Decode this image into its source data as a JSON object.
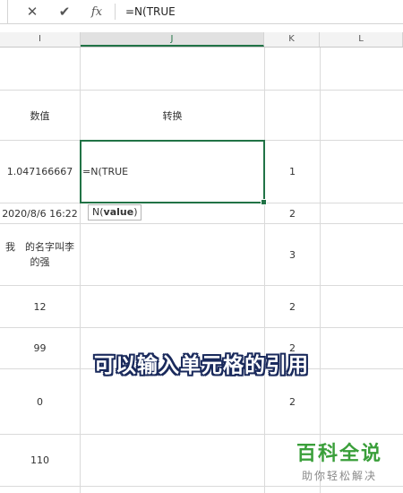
{
  "formula_bar": {
    "cancel_icon": "✕",
    "enter_icon": "✔",
    "fx_label": "fx",
    "content": "=N(TRUE"
  },
  "columns": [
    "I",
    "J",
    "K",
    "L"
  ],
  "selected_column": "J",
  "header_row": {
    "i": "数值",
    "j": "转换"
  },
  "rows": [
    {
      "i": "1.047166667",
      "j": "=N(TRUE",
      "k": "1"
    },
    {
      "i": "2020/8/6 16:22",
      "j": "",
      "k": "2"
    },
    {
      "i": "我　的名字叫李的强",
      "j": "",
      "k": "3"
    },
    {
      "i": "12",
      "j": "",
      "k": "2"
    },
    {
      "i": "99",
      "j": "",
      "k": "2"
    },
    {
      "i": "0",
      "j": "",
      "k": "2"
    },
    {
      "i": "110",
      "j": "",
      "k": ""
    }
  ],
  "tooltip": {
    "fn": "N(",
    "arg": "value",
    "close": ")"
  },
  "caption": "可以输入单元格的引用",
  "watermark": {
    "title": "百科全说",
    "subtitle": "助你轻松解决"
  },
  "colors": {
    "accent": "#217346",
    "watermark_green": "#3a9f3a"
  }
}
